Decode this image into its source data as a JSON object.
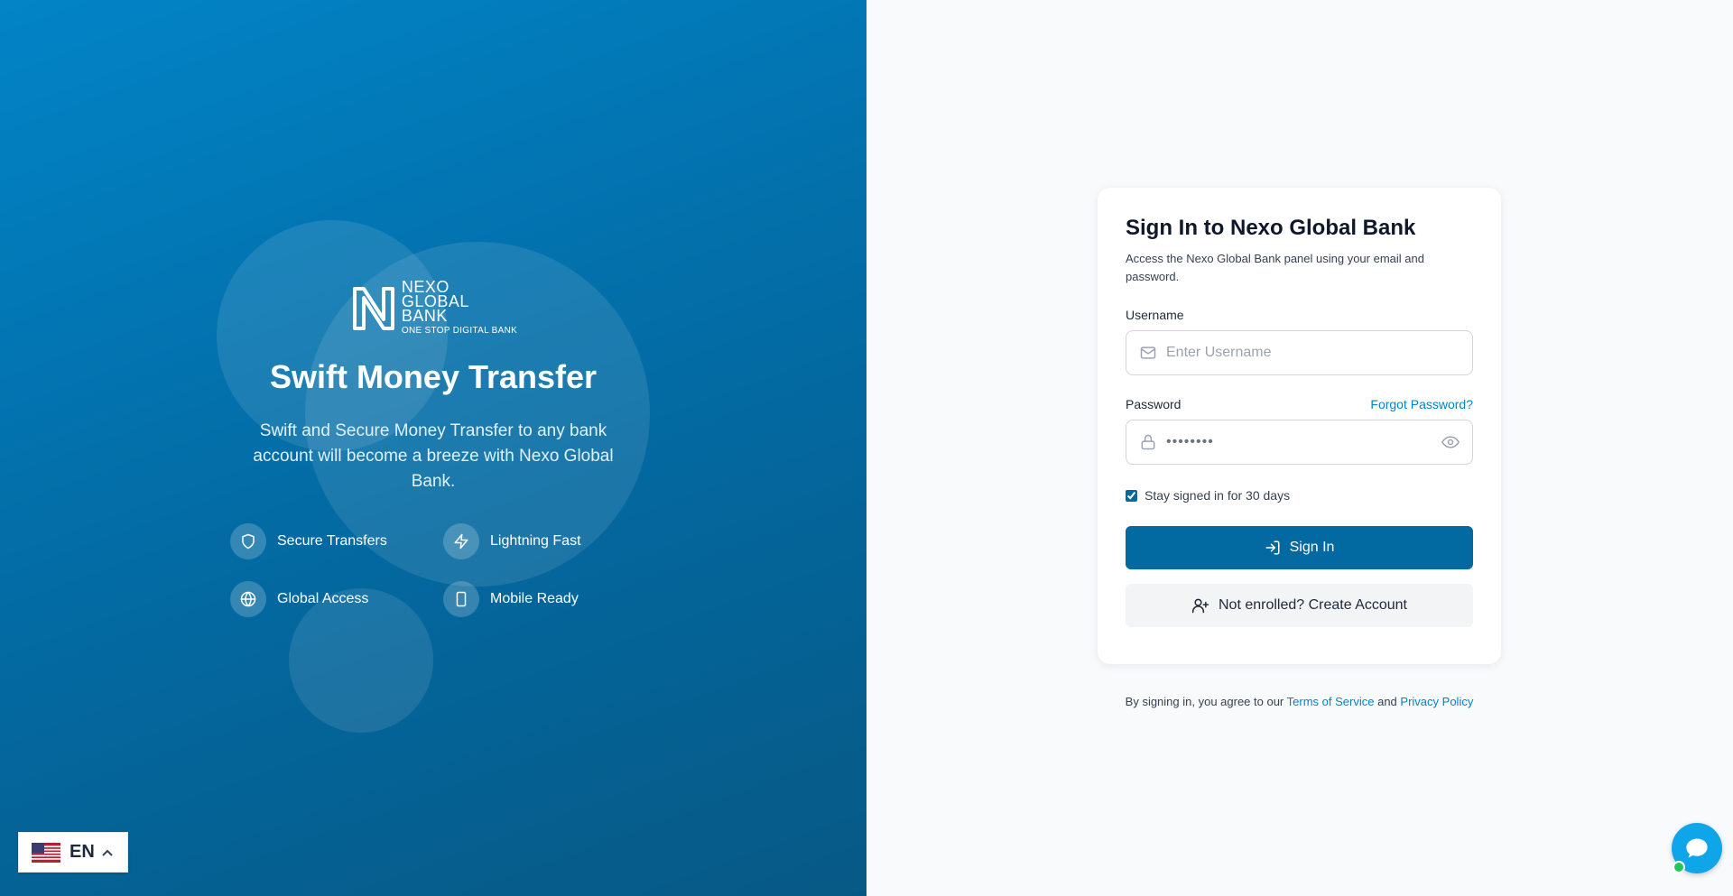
{
  "brand": {
    "logo_lines": [
      "NEXO",
      "GLOBAL",
      "BANK"
    ],
    "logo_tagline": "ONE STOP DIGITAL BANK"
  },
  "hero": {
    "title": "Swift Money Transfer",
    "description": "Swift and Secure Money Transfer to any bank account will become a breeze with Nexo Global Bank.",
    "features": [
      {
        "label": "Secure Transfers",
        "icon": "shield-icon"
      },
      {
        "label": "Lightning Fast",
        "icon": "lightning-icon"
      },
      {
        "label": "Global Access",
        "icon": "globe-icon"
      },
      {
        "label": "Mobile Ready",
        "icon": "smartphone-icon"
      }
    ]
  },
  "language": {
    "code": "EN",
    "flag": "us-flag-icon"
  },
  "login": {
    "title": "Sign In to Nexo Global Bank",
    "subtitle": "Access the Nexo Global Bank panel using your email and password.",
    "username_label": "Username",
    "username_placeholder": "Enter Username",
    "username_value": "",
    "password_label": "Password",
    "forgot_password": "Forgot Password?",
    "password_mask": "••••••••",
    "remember_label": "Stay signed in for 30 days",
    "remember_checked": true,
    "sign_in_label": "Sign In",
    "create_account_label": "Not enrolled? Create Account"
  },
  "terms": {
    "prefix": "By signing in, you agree to our",
    "terms_link": "Terms of Service",
    "conjunction": "and",
    "privacy_link": "Privacy Policy"
  },
  "colors": {
    "hero_start": "#0284c7",
    "hero_end": "#075985",
    "primary_button": "#0369a1",
    "link": "#0284c7",
    "chat_bubble": "#0ea5e9",
    "online_dot": "#22c55e"
  }
}
